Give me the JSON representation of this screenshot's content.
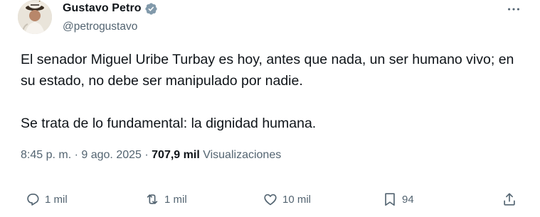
{
  "author": {
    "name": "Gustavo Petro",
    "handle": "@petrogustavo",
    "verified_color": "#829aab"
  },
  "tweet": {
    "text": "El senador Miguel Uribe Turbay es hoy, antes que nada, un ser humano vivo; en su estado, no debe ser manipulado por nadie.\n\nSe trata de lo fundamental: la dignidad humana.",
    "time": "8:45 p. m.",
    "sep": "·",
    "date": "9 ago. 2025",
    "views_count": "707,9 mil",
    "views_label": "Visualizaciones"
  },
  "actions": {
    "replies": "1 mil",
    "reposts": "1 mil",
    "likes": "10 mil",
    "bookmarks": "94"
  },
  "icons": {
    "more": "more-icon",
    "reply": "reply-icon",
    "repost": "repost-icon",
    "like": "like-icon",
    "bookmark": "bookmark-icon",
    "share": "share-icon"
  }
}
